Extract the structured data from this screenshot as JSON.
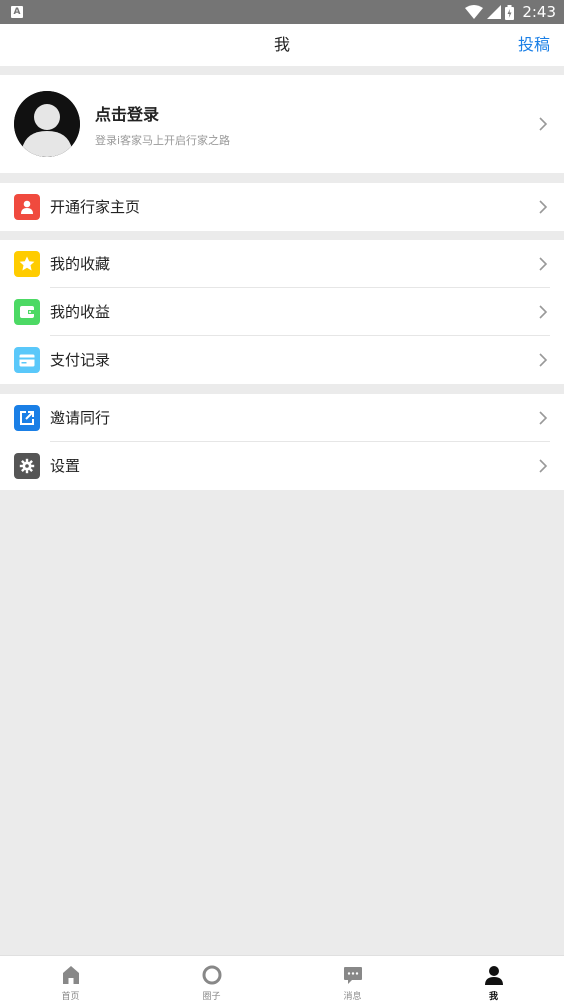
{
  "status_bar": {
    "time": "2:43",
    "app_badge": "A"
  },
  "header": {
    "title": "我",
    "action": "投稿"
  },
  "profile": {
    "name": "点击登录",
    "subtitle": "登录i客家马上开启行家之路"
  },
  "groups": [
    {
      "items": [
        {
          "label": "开通行家主页",
          "icon": "person-icon",
          "color": "#f04a3e"
        }
      ]
    },
    {
      "items": [
        {
          "label": "我的收藏",
          "icon": "star-icon",
          "color": "#ffcc00"
        },
        {
          "label": "我的收益",
          "icon": "wallet-icon",
          "color": "#4cd964"
        },
        {
          "label": "支付记录",
          "icon": "card-icon",
          "color": "#5ac8fa"
        }
      ]
    },
    {
      "items": [
        {
          "label": "邀请同行",
          "icon": "share-icon",
          "color": "#1a7fe6"
        },
        {
          "label": "设置",
          "icon": "gear-icon",
          "color": "#555555"
        }
      ]
    }
  ],
  "tabbar": {
    "tabs": [
      {
        "label": "首页",
        "icon": "home-icon"
      },
      {
        "label": "圈子",
        "icon": "circle-icon"
      },
      {
        "label": "消息",
        "icon": "chat-icon"
      },
      {
        "label": "我",
        "icon": "user-icon",
        "active": true
      }
    ]
  }
}
